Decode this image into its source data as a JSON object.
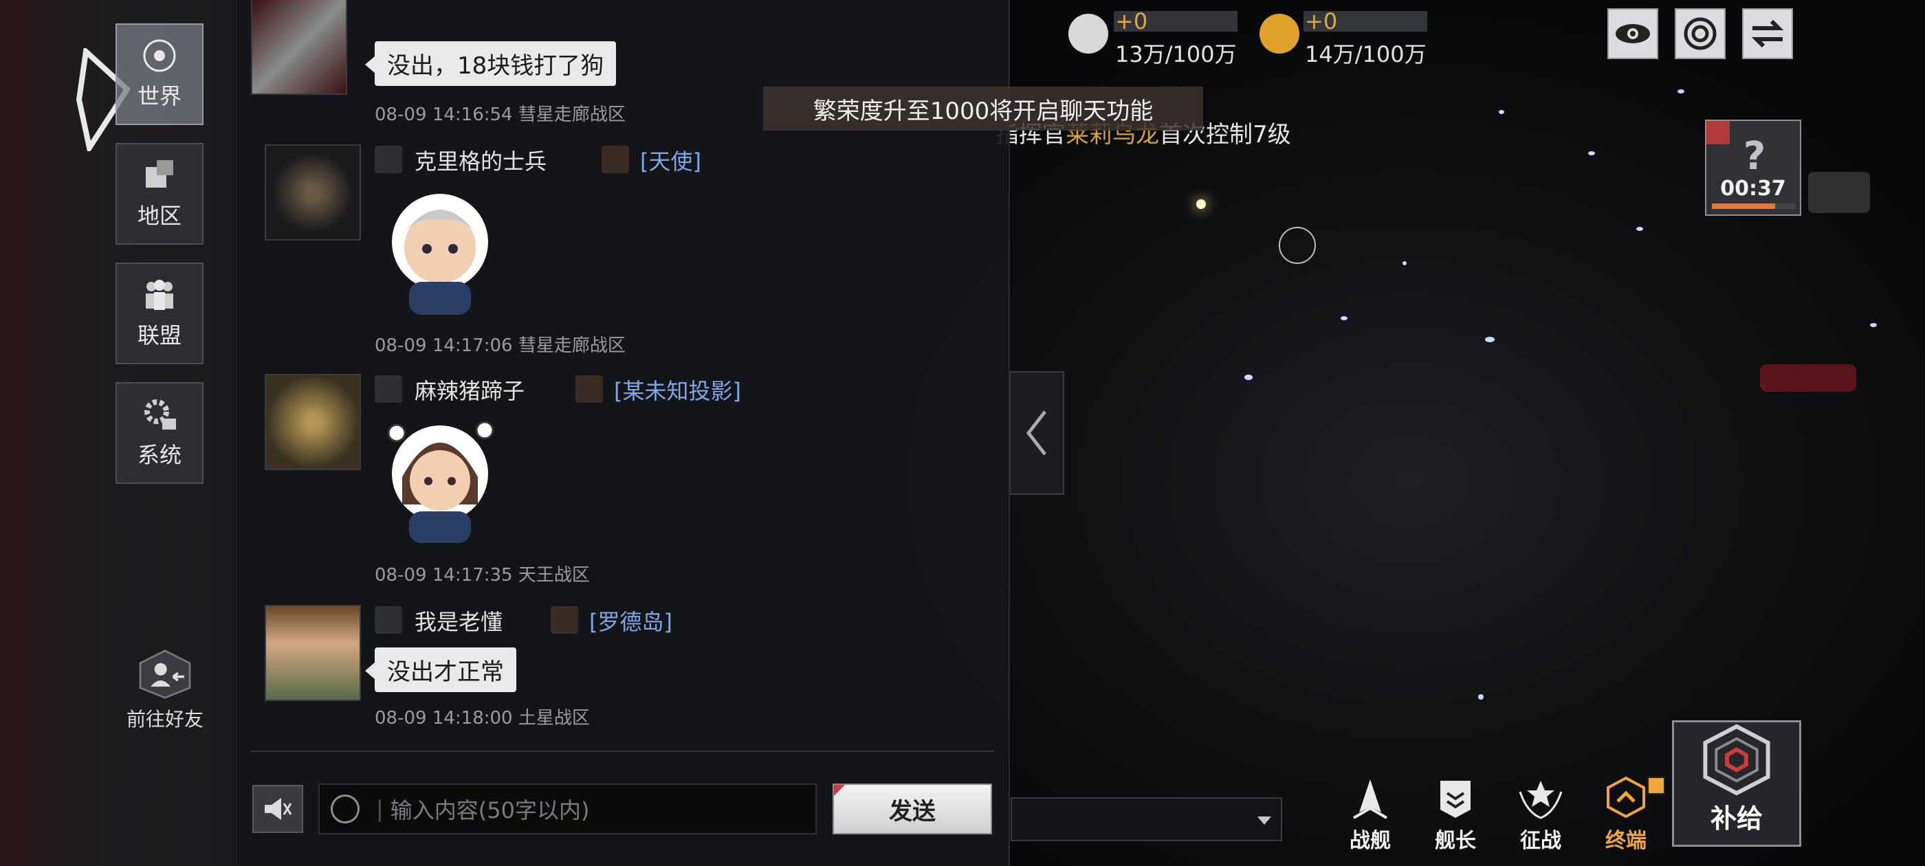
{
  "notice": "繁荣度升至1000将开启聊天功能",
  "map_event_text": {
    "prefix": "指挥官",
    "name": "莱莉乌龙",
    "suffix": "首次控制7级"
  },
  "resources": [
    {
      "plus": "+0",
      "value": "13万/100万",
      "color": "#d8d8d8"
    },
    {
      "plus": "+0",
      "value": "14万/100万",
      "color": "#e0a12a"
    }
  ],
  "top_buttons": [
    "eye-icon",
    "radar-icon",
    "swap-icon"
  ],
  "left_nav": [
    {
      "label": "世界",
      "icon": "planet-icon",
      "active": true
    },
    {
      "label": "地区",
      "icon": "region-icon",
      "active": false
    },
    {
      "label": "联盟",
      "icon": "alliance-icon",
      "active": false
    },
    {
      "label": "系统",
      "icon": "system-gear-icon",
      "active": false
    }
  ],
  "friend_button": "前往好友",
  "messages": [
    {
      "sender": "",
      "guild": "",
      "text": "没出，18块钱打了狗",
      "time": "08-09 14:16:54 彗星走廊战区"
    },
    {
      "sender": "克里格的士兵",
      "guild": "[天使]",
      "text": "",
      "time": "08-09 14:17:06 彗星走廊战区"
    },
    {
      "sender": "麻辣猪蹄子",
      "guild": "[某未知投影]",
      "text": "",
      "time": "08-09 14:17:35 天王战区"
    },
    {
      "sender": "我是老懂",
      "guild": "[罗德岛]",
      "text": "没出才正常",
      "time": "08-09 14:18:00 土星战区"
    }
  ],
  "input": {
    "placeholder": "输入内容(50字以内)"
  },
  "send_label": "发送",
  "timer": {
    "time": "00:37",
    "progress": 0.75
  },
  "bottom_menu": [
    {
      "label": "战舰",
      "icon": "warship-icon",
      "highlight": false
    },
    {
      "label": "舰长",
      "icon": "captain-icon",
      "highlight": false
    },
    {
      "label": "征战",
      "icon": "battle-icon",
      "highlight": false
    },
    {
      "label": "终端",
      "icon": "terminal-icon",
      "highlight": true
    }
  ],
  "supply_label": "补给",
  "colors": {
    "accent": "#d6a23a",
    "guild": "#7fa6e6",
    "alert": "#d13a3a"
  }
}
